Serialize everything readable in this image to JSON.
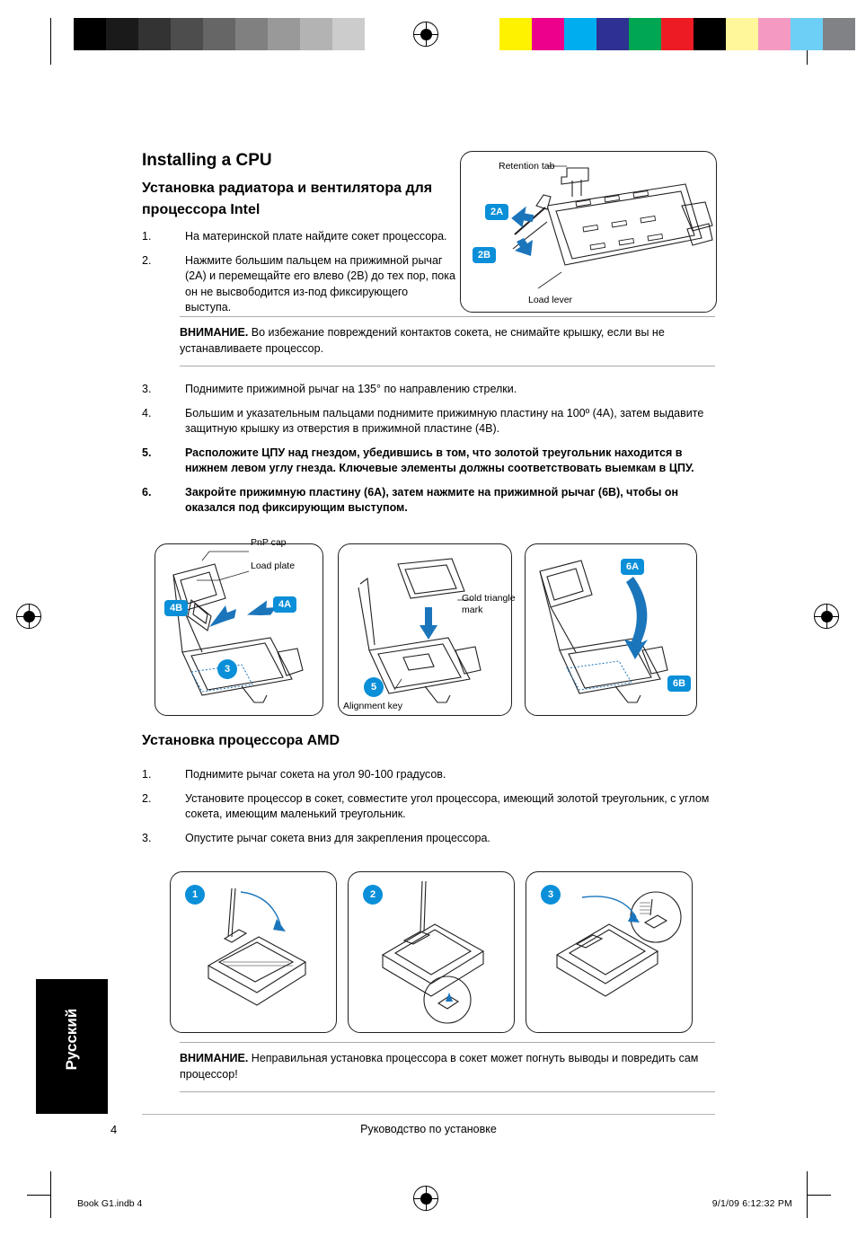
{
  "doc": {
    "title": "Installing a CPU",
    "subtitle": "Установка радиатора и вентилятора для процессора Intel",
    "amd_heading": "Установка процессора  AMD"
  },
  "intel_steps_top": [
    {
      "num": "1.",
      "text": "На материнской плате найдите сокет процессора."
    },
    {
      "num": "2.",
      "text": "Нажмите большим пальцем на прижимной рычаг (2A) и перемещайте его влево (2B) до тех пор, пока он не высвободится из-под фиксирующего выступа."
    }
  ],
  "note_top": {
    "label": "ВНИМАНИЕ.",
    "text": "Во избежание повреждений контактов сокета, не снимайте крышку, если вы не устанавливаете процессор."
  },
  "intel_steps_bottom": [
    {
      "num": "3.",
      "text": "Поднимите прижимной рычаг на 135° по направлению стрелки.",
      "bold": false
    },
    {
      "num": "4.",
      "text": "Большим и указательным пальцами поднимите прижимную пластину на 100º (4A), затем выдавите защитную крышку из отверстия в прижимной пластине (4B).",
      "bold": false
    },
    {
      "num": "5.",
      "text": "Расположите ЦПУ над гнездом, убедившись в том, что золотой треугольник находится в нижнем левом углу гнезда. Ключевые элементы должны соответствовать выемкам в ЦПУ.",
      "bold": true
    },
    {
      "num": "6.",
      "text": "Закройте прижимную пластину (6A), затем нажмите на прижимной рычаг (6B), чтобы он оказался под фиксирующим выступом.",
      "bold": true
    }
  ],
  "amd_steps": [
    {
      "num": "1.",
      "text": "Поднимите рычаг сокета на угол 90-100 градусов."
    },
    {
      "num": "2.",
      "text": "Установите процессор в сокет, совместите угол процессора, имеющий золотой треугольник,  с углом сокета, имеющим маленький треугольник."
    },
    {
      "num": "3.",
      "text": "Опустите рычаг сокета вниз для закрепления процессора."
    }
  ],
  "note_bottom": {
    "label": "ВНИМАНИЕ.",
    "text": "Неправильная установка процессора в сокет может погнуть выводы и повредить сам процессор!"
  },
  "figures": {
    "intel_top": {
      "callout_retention": "Retention tab",
      "callout_lever": "Load lever",
      "badge_2a": "2A",
      "badge_2b": "2B"
    },
    "fig4": {
      "callout_pnp": "PnP cap",
      "callout_plate": "Load plate",
      "badge_4b": "4B",
      "badge_4a": "4A",
      "badge_3": "3"
    },
    "fig5": {
      "callout_gold": "Gold triangle mark",
      "callout_align": "Alignment key",
      "badge_5": "5"
    },
    "fig6": {
      "badge_6a": "6A",
      "badge_6b": "6B"
    },
    "amd": {
      "badge_1": "1",
      "badge_2": "2",
      "badge_3": "3"
    }
  },
  "sidebar": {
    "language": "Русский"
  },
  "footer": {
    "page_number": "4",
    "center_text": "Руководство по установке",
    "file_name": "Book G1.indb   4",
    "timestamp": "9/1/09   6:12:32 PM"
  },
  "colors": {
    "accent": "#0a8fd8",
    "rule": "#aaaaaa",
    "ink": "#231f20"
  },
  "printer_marks": {
    "grayscale": [
      "#000000",
      "#1a1a1a",
      "#333333",
      "#4d4d4d",
      "#666666",
      "#808080",
      "#999999",
      "#b3b3b3",
      "#cccccc",
      "#ffffff"
    ],
    "process": [
      "#fff200",
      "#ec008c",
      "#00aeef",
      "#2e3192",
      "#00a651",
      "#ed1c24",
      "#000000",
      "#fff799",
      "#f49ac1",
      "#6dcff6",
      "#808285"
    ]
  }
}
